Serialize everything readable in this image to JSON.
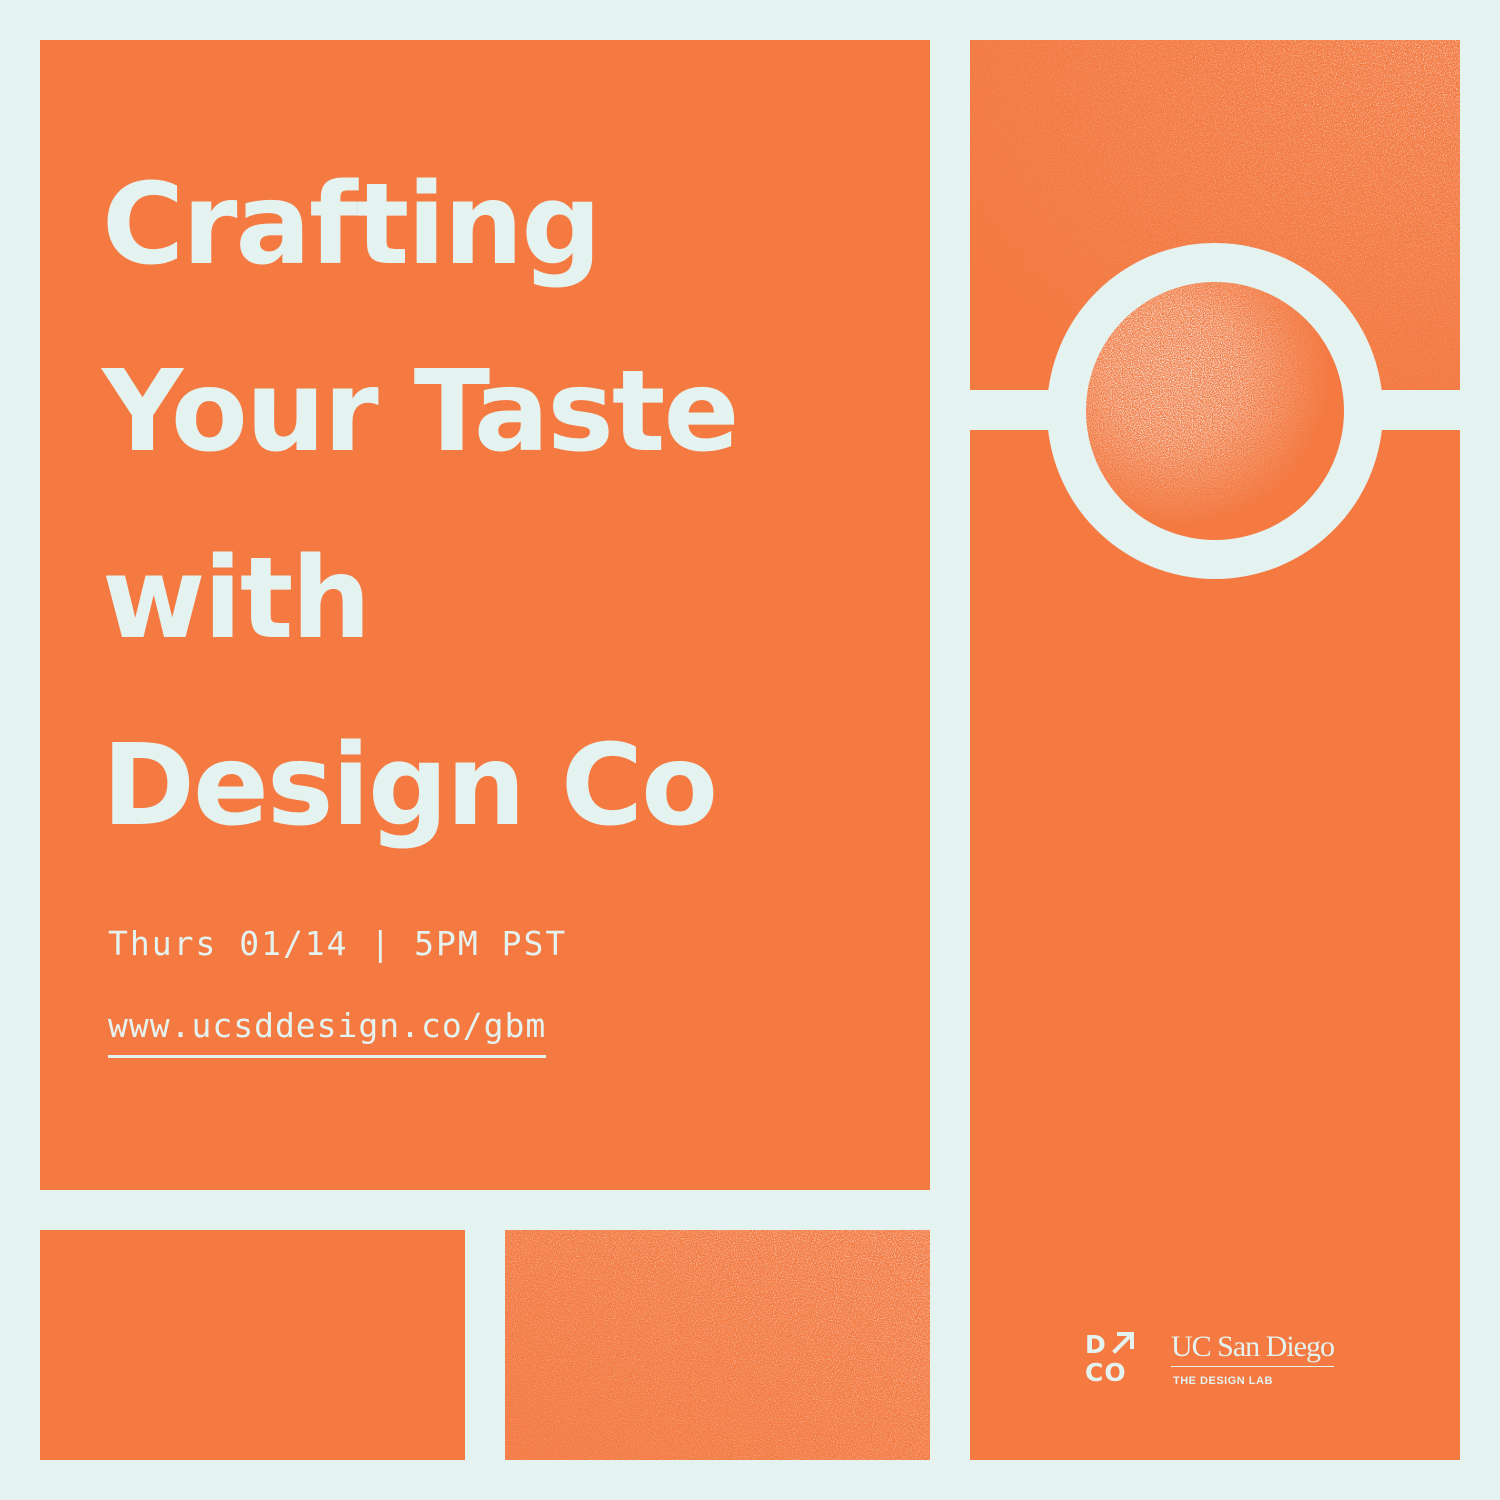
{
  "title": {
    "lines": [
      "Crafting",
      "Your Taste",
      "with",
      "Design Co"
    ]
  },
  "event": {
    "date_time": "Thurs 01/14 | 5PM PST",
    "url": "www.ucsddesign.co/gbm"
  },
  "logos": {
    "dco": {
      "top": "D",
      "bottom": "CO"
    },
    "ucsd": {
      "name": "UC San Diego",
      "subtitle": "THE DESIGN LAB"
    }
  },
  "colors": {
    "background": "#e4f2f0",
    "accent": "#f47a42",
    "text": "#e4f2f0"
  }
}
